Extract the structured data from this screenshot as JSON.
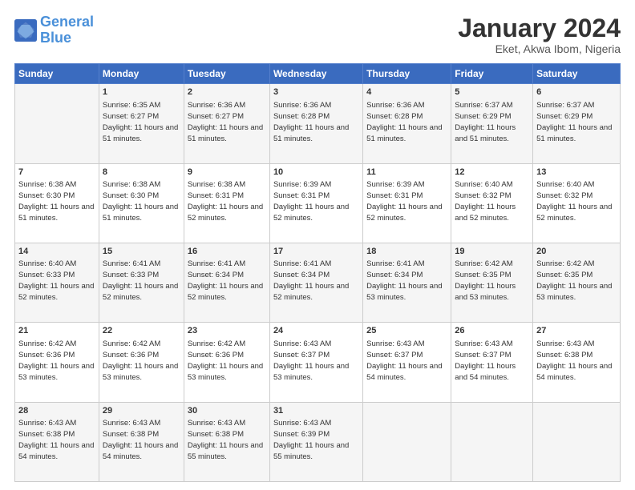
{
  "header": {
    "logo_general": "General",
    "logo_blue": "Blue",
    "title": "January 2024",
    "subtitle": "Eket, Akwa Ibom, Nigeria"
  },
  "days_of_week": [
    "Sunday",
    "Monday",
    "Tuesday",
    "Wednesday",
    "Thursday",
    "Friday",
    "Saturday"
  ],
  "weeks": [
    [
      {
        "day": "",
        "sunrise": "",
        "sunset": "",
        "daylight": ""
      },
      {
        "day": "1",
        "sunrise": "Sunrise: 6:35 AM",
        "sunset": "Sunset: 6:27 PM",
        "daylight": "Daylight: 11 hours and 51 minutes."
      },
      {
        "day": "2",
        "sunrise": "Sunrise: 6:36 AM",
        "sunset": "Sunset: 6:27 PM",
        "daylight": "Daylight: 11 hours and 51 minutes."
      },
      {
        "day": "3",
        "sunrise": "Sunrise: 6:36 AM",
        "sunset": "Sunset: 6:28 PM",
        "daylight": "Daylight: 11 hours and 51 minutes."
      },
      {
        "day": "4",
        "sunrise": "Sunrise: 6:36 AM",
        "sunset": "Sunset: 6:28 PM",
        "daylight": "Daylight: 11 hours and 51 minutes."
      },
      {
        "day": "5",
        "sunrise": "Sunrise: 6:37 AM",
        "sunset": "Sunset: 6:29 PM",
        "daylight": "Daylight: 11 hours and 51 minutes."
      },
      {
        "day": "6",
        "sunrise": "Sunrise: 6:37 AM",
        "sunset": "Sunset: 6:29 PM",
        "daylight": "Daylight: 11 hours and 51 minutes."
      }
    ],
    [
      {
        "day": "7",
        "sunrise": "Sunrise: 6:38 AM",
        "sunset": "Sunset: 6:30 PM",
        "daylight": "Daylight: 11 hours and 51 minutes."
      },
      {
        "day": "8",
        "sunrise": "Sunrise: 6:38 AM",
        "sunset": "Sunset: 6:30 PM",
        "daylight": "Daylight: 11 hours and 51 minutes."
      },
      {
        "day": "9",
        "sunrise": "Sunrise: 6:38 AM",
        "sunset": "Sunset: 6:31 PM",
        "daylight": "Daylight: 11 hours and 52 minutes."
      },
      {
        "day": "10",
        "sunrise": "Sunrise: 6:39 AM",
        "sunset": "Sunset: 6:31 PM",
        "daylight": "Daylight: 11 hours and 52 minutes."
      },
      {
        "day": "11",
        "sunrise": "Sunrise: 6:39 AM",
        "sunset": "Sunset: 6:31 PM",
        "daylight": "Daylight: 11 hours and 52 minutes."
      },
      {
        "day": "12",
        "sunrise": "Sunrise: 6:40 AM",
        "sunset": "Sunset: 6:32 PM",
        "daylight": "Daylight: 11 hours and 52 minutes."
      },
      {
        "day": "13",
        "sunrise": "Sunrise: 6:40 AM",
        "sunset": "Sunset: 6:32 PM",
        "daylight": "Daylight: 11 hours and 52 minutes."
      }
    ],
    [
      {
        "day": "14",
        "sunrise": "Sunrise: 6:40 AM",
        "sunset": "Sunset: 6:33 PM",
        "daylight": "Daylight: 11 hours and 52 minutes."
      },
      {
        "day": "15",
        "sunrise": "Sunrise: 6:41 AM",
        "sunset": "Sunset: 6:33 PM",
        "daylight": "Daylight: 11 hours and 52 minutes."
      },
      {
        "day": "16",
        "sunrise": "Sunrise: 6:41 AM",
        "sunset": "Sunset: 6:34 PM",
        "daylight": "Daylight: 11 hours and 52 minutes."
      },
      {
        "day": "17",
        "sunrise": "Sunrise: 6:41 AM",
        "sunset": "Sunset: 6:34 PM",
        "daylight": "Daylight: 11 hours and 52 minutes."
      },
      {
        "day": "18",
        "sunrise": "Sunrise: 6:41 AM",
        "sunset": "Sunset: 6:34 PM",
        "daylight": "Daylight: 11 hours and 53 minutes."
      },
      {
        "day": "19",
        "sunrise": "Sunrise: 6:42 AM",
        "sunset": "Sunset: 6:35 PM",
        "daylight": "Daylight: 11 hours and 53 minutes."
      },
      {
        "day": "20",
        "sunrise": "Sunrise: 6:42 AM",
        "sunset": "Sunset: 6:35 PM",
        "daylight": "Daylight: 11 hours and 53 minutes."
      }
    ],
    [
      {
        "day": "21",
        "sunrise": "Sunrise: 6:42 AM",
        "sunset": "Sunset: 6:36 PM",
        "daylight": "Daylight: 11 hours and 53 minutes."
      },
      {
        "day": "22",
        "sunrise": "Sunrise: 6:42 AM",
        "sunset": "Sunset: 6:36 PM",
        "daylight": "Daylight: 11 hours and 53 minutes."
      },
      {
        "day": "23",
        "sunrise": "Sunrise: 6:42 AM",
        "sunset": "Sunset: 6:36 PM",
        "daylight": "Daylight: 11 hours and 53 minutes."
      },
      {
        "day": "24",
        "sunrise": "Sunrise: 6:43 AM",
        "sunset": "Sunset: 6:37 PM",
        "daylight": "Daylight: 11 hours and 53 minutes."
      },
      {
        "day": "25",
        "sunrise": "Sunrise: 6:43 AM",
        "sunset": "Sunset: 6:37 PM",
        "daylight": "Daylight: 11 hours and 54 minutes."
      },
      {
        "day": "26",
        "sunrise": "Sunrise: 6:43 AM",
        "sunset": "Sunset: 6:37 PM",
        "daylight": "Daylight: 11 hours and 54 minutes."
      },
      {
        "day": "27",
        "sunrise": "Sunrise: 6:43 AM",
        "sunset": "Sunset: 6:38 PM",
        "daylight": "Daylight: 11 hours and 54 minutes."
      }
    ],
    [
      {
        "day": "28",
        "sunrise": "Sunrise: 6:43 AM",
        "sunset": "Sunset: 6:38 PM",
        "daylight": "Daylight: 11 hours and 54 minutes."
      },
      {
        "day": "29",
        "sunrise": "Sunrise: 6:43 AM",
        "sunset": "Sunset: 6:38 PM",
        "daylight": "Daylight: 11 hours and 54 minutes."
      },
      {
        "day": "30",
        "sunrise": "Sunrise: 6:43 AM",
        "sunset": "Sunset: 6:38 PM",
        "daylight": "Daylight: 11 hours and 55 minutes."
      },
      {
        "day": "31",
        "sunrise": "Sunrise: 6:43 AM",
        "sunset": "Sunset: 6:39 PM",
        "daylight": "Daylight: 11 hours and 55 minutes."
      },
      {
        "day": "",
        "sunrise": "",
        "sunset": "",
        "daylight": ""
      },
      {
        "day": "",
        "sunrise": "",
        "sunset": "",
        "daylight": ""
      },
      {
        "day": "",
        "sunrise": "",
        "sunset": "",
        "daylight": ""
      }
    ]
  ]
}
